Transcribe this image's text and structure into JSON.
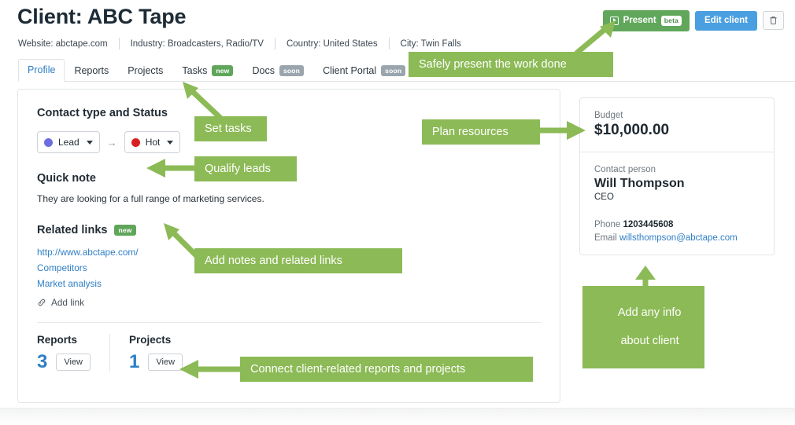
{
  "header": {
    "title": "Client: ABC Tape",
    "meta": [
      "Website: abctape.com",
      "Industry: Broadcasters, Radio/TV",
      "Country: United States",
      "City: Twin Falls"
    ]
  },
  "actions": {
    "present_label": "Present",
    "present_badge": "beta",
    "edit_label": "Edit client",
    "present_icon": "play-icon",
    "delete_icon": "trash-icon"
  },
  "tabs": [
    {
      "label": "Profile",
      "badge": "",
      "active": true
    },
    {
      "label": "Reports",
      "badge": "",
      "active": false
    },
    {
      "label": "Projects",
      "badge": "",
      "active": false
    },
    {
      "label": "Tasks",
      "badge": "new",
      "badge_kind": "new",
      "active": false
    },
    {
      "label": "Docs",
      "badge": "soon",
      "badge_kind": "soon",
      "active": false
    },
    {
      "label": "Client Portal",
      "badge": "soon",
      "badge_kind": "soon",
      "active": false
    }
  ],
  "main": {
    "contact_status_title": "Contact type and Status",
    "contact_type": {
      "label": "Lead",
      "color": "#6c6ee0"
    },
    "status": {
      "label": "Hot",
      "color": "#d92020"
    },
    "arrow_glyph": "→",
    "quick_note_title": "Quick note",
    "quick_note_text": "They are looking for a full range of marketing services.",
    "related_links_title": "Related links",
    "related_links_badge": "new",
    "links": [
      "http://www.abctape.com/",
      "Competitors",
      "Market analysis"
    ],
    "add_link_label": "Add link",
    "add_link_icon": "link-icon",
    "counts": [
      {
        "label": "Reports",
        "value": "3",
        "button": "View"
      },
      {
        "label": "Projects",
        "value": "1",
        "button": "View"
      }
    ]
  },
  "sidebar": {
    "budget_label": "Budget",
    "budget_value": "$10,000.00",
    "contact_person_label": "Contact person",
    "contact_person_name": "Will Thompson",
    "contact_person_role": "CEO",
    "phone_label": "Phone",
    "phone_value": "1203445608",
    "email_label": "Email",
    "email_value": "willsthompson@abctape.com"
  },
  "annotations": {
    "accent_color": "#8cba56",
    "present": "Safely present the work done",
    "set_tasks": "Set tasks",
    "qualify_leads": "Qualify leads",
    "plan_resources": "Plan resources",
    "add_notes": "Add notes and related links",
    "connect": "Connect client-related reports and projects",
    "add_info_line1": "Add any info",
    "add_info_line2": "about client"
  }
}
